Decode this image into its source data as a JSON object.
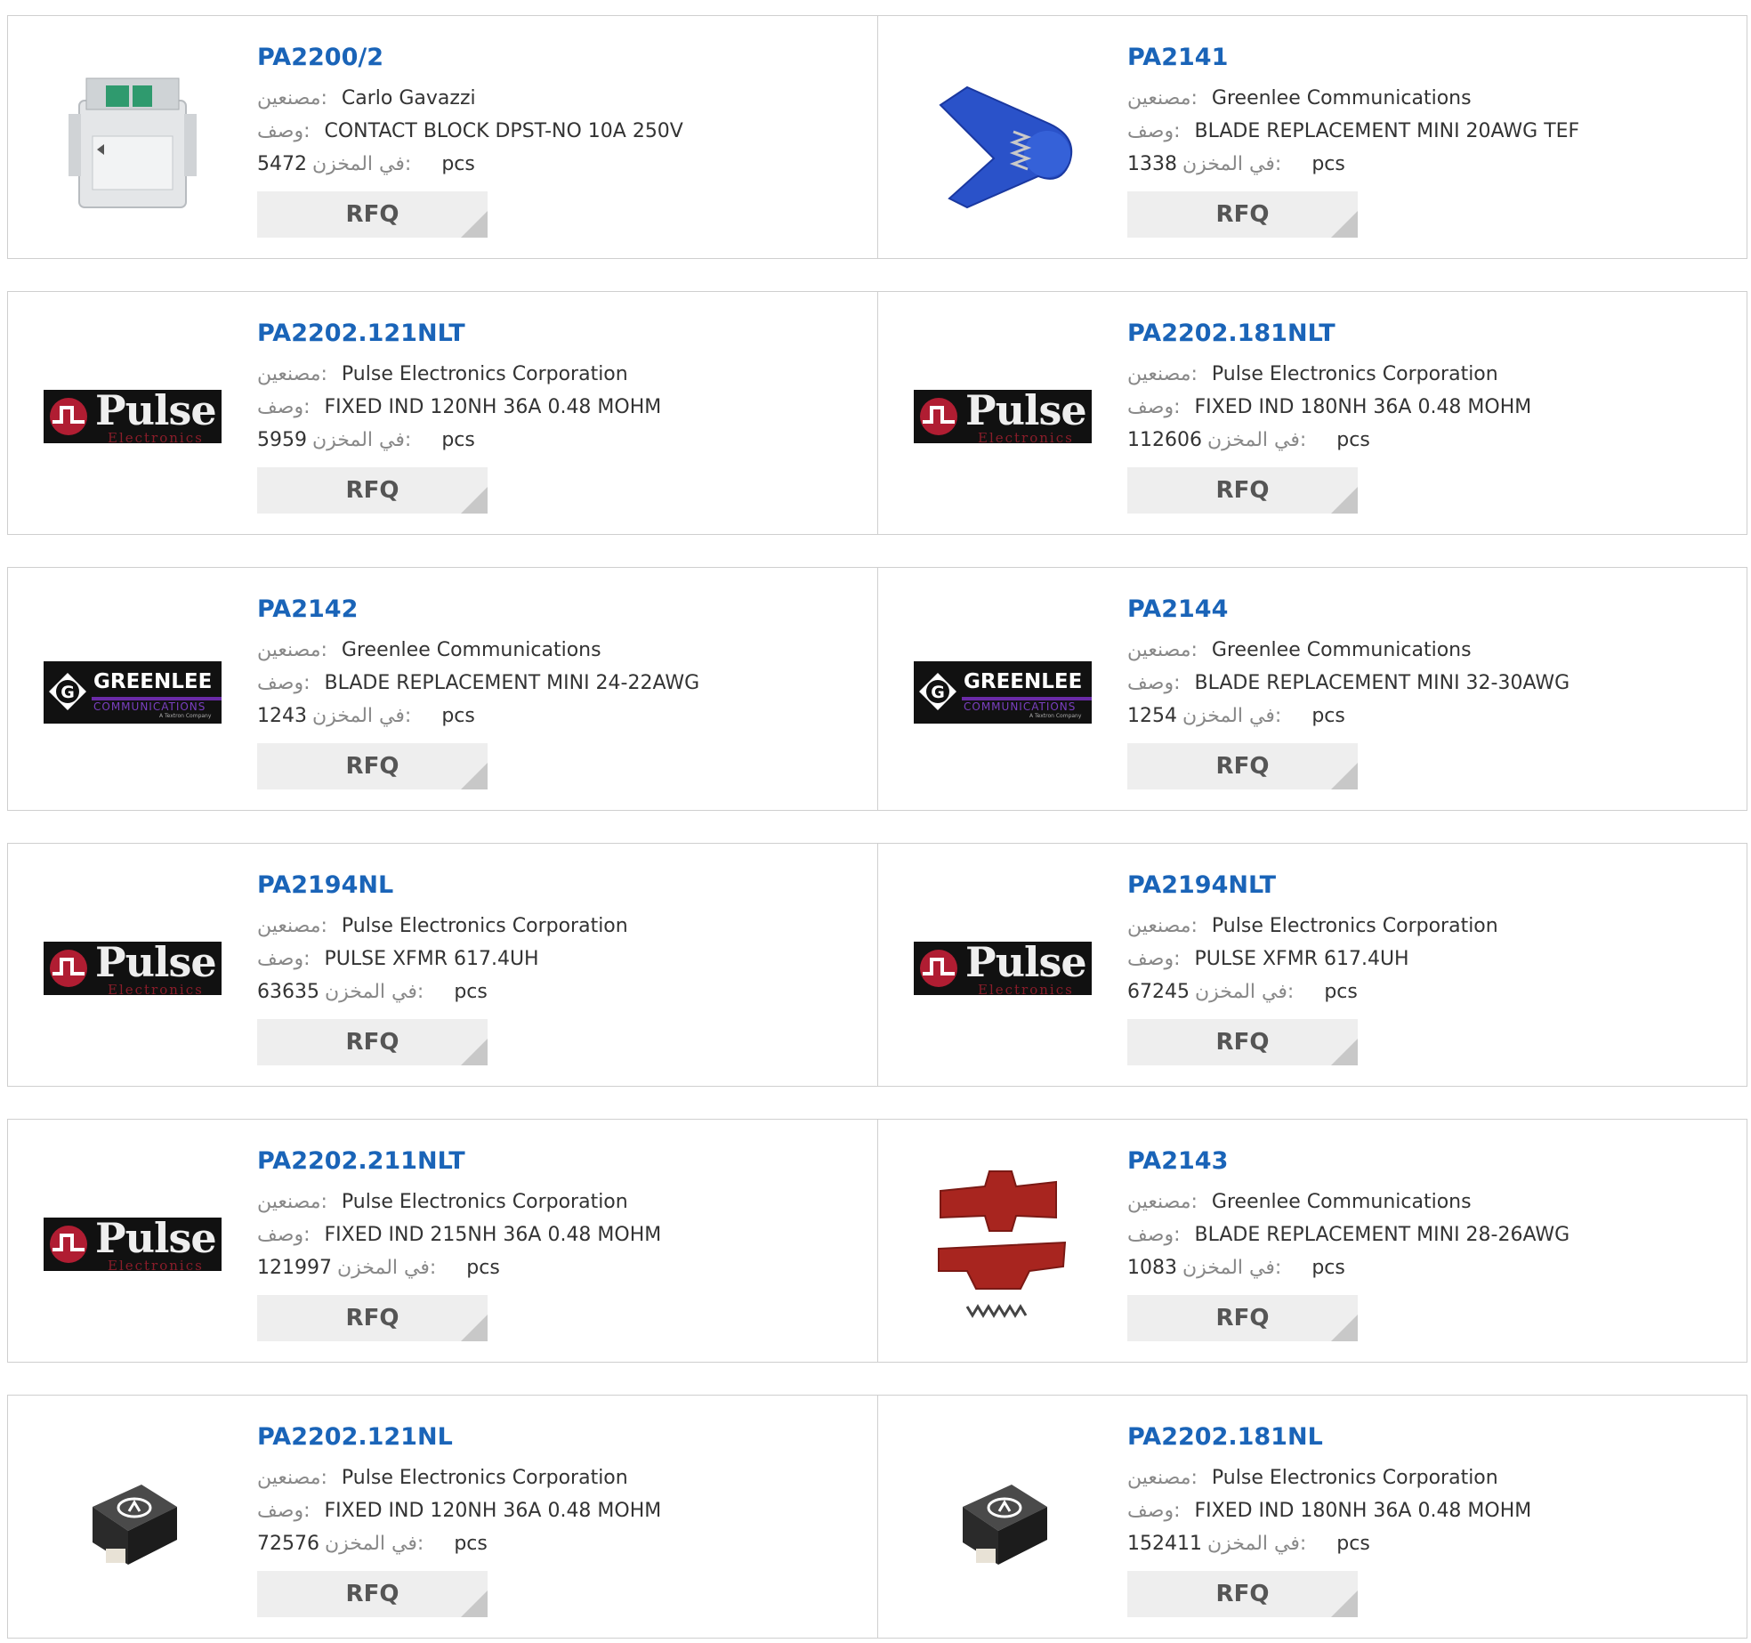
{
  "labels": {
    "manufacturer": "مصنعين:",
    "description": "وصف:",
    "stock": "في المخزن:",
    "unit": "pcs",
    "rfq": "RFQ"
  },
  "products": [
    {
      "part": "PA2200/2",
      "manufacturer": "Carlo Gavazzi",
      "description": "CONTACT BLOCK DPST-NO 10A 250V",
      "stock": "5472",
      "image": "contact-block-photo"
    },
    {
      "part": "PA2141",
      "manufacturer": "Greenlee Communications",
      "description": "BLADE REPLACEMENT MINI 20AWG TEF",
      "stock": "1338",
      "image": "blue-stripper-blade-photo"
    },
    {
      "part": "PA2202.121NLT",
      "manufacturer": "Pulse Electronics Corporation",
      "description": "FIXED IND 120NH 36A 0.48 MOHM",
      "stock": "5959",
      "image": "pulse-logo"
    },
    {
      "part": "PA2202.181NLT",
      "manufacturer": "Pulse Electronics Corporation",
      "description": "FIXED IND 180NH 36A 0.48 MOHM",
      "stock": "112606",
      "image": "pulse-logo"
    },
    {
      "part": "PA2142",
      "manufacturer": "Greenlee Communications",
      "description": "BLADE REPLACEMENT MINI 24-22AWG",
      "stock": "1243",
      "image": "greenlee-logo"
    },
    {
      "part": "PA2144",
      "manufacturer": "Greenlee Communications",
      "description": "BLADE REPLACEMENT MINI 32-30AWG",
      "stock": "1254",
      "image": "greenlee-logo"
    },
    {
      "part": "PA2194NL",
      "manufacturer": "Pulse Electronics Corporation",
      "description": "PULSE XFMR 617.4UH",
      "stock": "63635",
      "image": "pulse-logo"
    },
    {
      "part": "PA2194NLT",
      "manufacturer": "Pulse Electronics Corporation",
      "description": "PULSE XFMR 617.4UH",
      "stock": "67245",
      "image": "pulse-logo"
    },
    {
      "part": "PA2202.211NLT",
      "manufacturer": "Pulse Electronics Corporation",
      "description": "FIXED IND 215NH 36A 0.48 MOHM",
      "stock": "121997",
      "image": "pulse-logo"
    },
    {
      "part": "PA2143",
      "manufacturer": "Greenlee Communications",
      "description": "BLADE REPLACEMENT MINI 28-26AWG",
      "stock": "1083",
      "image": "red-stripper-blade-photo"
    },
    {
      "part": "PA2202.121NL",
      "manufacturer": "Pulse Electronics Corporation",
      "description": "FIXED IND 120NH 36A 0.48 MOHM",
      "stock": "72576",
      "image": "inductor-photo"
    },
    {
      "part": "PA2202.181NL",
      "manufacturer": "Pulse Electronics Corporation",
      "description": "FIXED IND 180NH 36A 0.48 MOHM",
      "stock": "152411",
      "image": "inductor-photo"
    }
  ],
  "logo_text": {
    "pulse_word": "Pulse",
    "pulse_sub": "Electronics",
    "greenlee_word": "GREENLEE",
    "greenlee_sub": "COMMUNICATIONS",
    "greenlee_tiny": "A Textron Company"
  },
  "colors": {
    "part_link": "#1a64b8",
    "label": "#888888",
    "rfq_bg": "#eeeeee",
    "border": "#cfcfcf"
  }
}
